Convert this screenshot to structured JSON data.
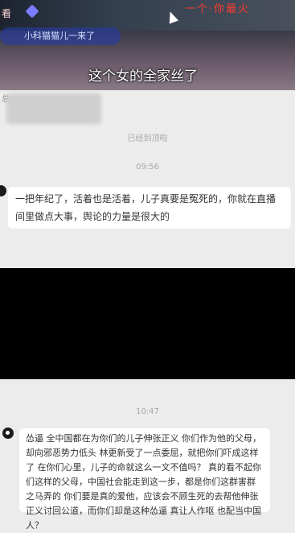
{
  "video": {
    "overlay_left": "看",
    "overlay_pill": "小科猫猫儿一来了",
    "overlay_top_right": "一个·你最火",
    "subtitle": "这个女的全家丝了",
    "corner_mark": "总"
  },
  "chat": {
    "status_note": "已经到顶啦",
    "time_1": "09:56",
    "message_1": "一把年纪了，活着也是活着，儿子真要是冤死的，你就在直播间里做点大事，舆论的力量是很大的",
    "time_2": "10:47",
    "message_2": "怂逼 全中国都在为你们的儿子伸张正义 你们作为他的父母，却向邪恶势力低头 林更新受了一点委屈，就把你们吓成这样了 在你们心里，儿子的命就这么一文不值吗？ 真的看不起你们这样的父母，中国社会能走到这一步，都是你们这群害群之马弄的 你们要是真的爱他，应该会不顾生死的去帮他伸张正义讨回公道，而你们却是这种怂逼 真让人作呕 也配当中国人？"
  },
  "colors": {
    "background": "#ececec",
    "bubble": "#ffffff",
    "band": "#000000"
  }
}
